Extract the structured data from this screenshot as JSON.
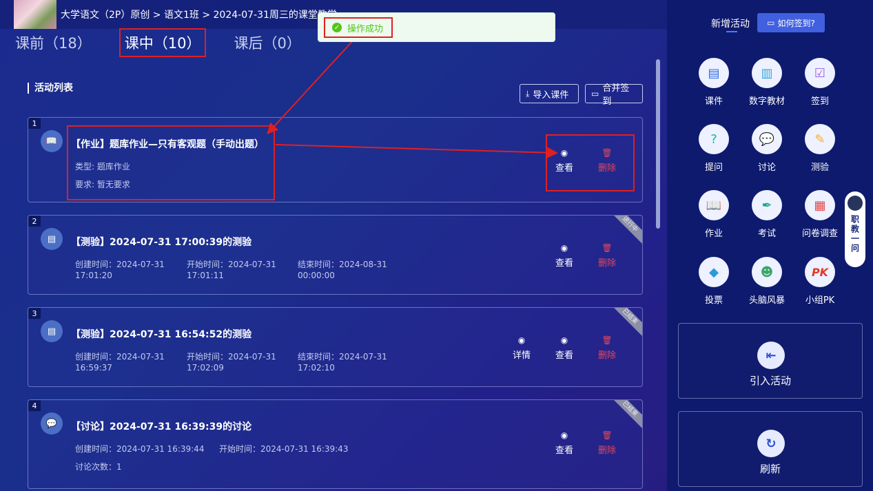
{
  "header": {
    "breadcrumb": "大学语文（2P）原创 > 语文1班 > 2024-07-31周三的课堂教学"
  },
  "tabs": [
    {
      "label": "课前（18）"
    },
    {
      "label": "课中（10）"
    },
    {
      "label": "课后（0）"
    }
  ],
  "toast": {
    "text": "操作成功"
  },
  "section": {
    "title": "活动列表",
    "import_label": "导入课件",
    "merge_label": "合并签到"
  },
  "activities": [
    {
      "index": "1",
      "title": "【作业】题库作业—只有客观题（手动出题）",
      "line1": "类型: 题库作业",
      "line2": "要求: 暂无要求",
      "view": "查看",
      "delete": "删除"
    },
    {
      "index": "2",
      "title": "【测验】2024-07-31 17:00:39的测验",
      "badge": "进行中",
      "created_label": "创建时间：2024-07-31",
      "created_time": "17:01:20",
      "start_label": "开始时间：2024-07-31",
      "start_time": "17:01:11",
      "end_label": "结束时间：2024-08-31",
      "end_time": "00:00:00",
      "view": "查看",
      "delete": "删除"
    },
    {
      "index": "3",
      "title": "【测验】2024-07-31 16:54:52的测验",
      "badge": "已结束",
      "created_label": "创建时间：2024-07-31",
      "created_time": "16:59:37",
      "start_label": "开始时间：2024-07-31",
      "start_time": "17:02:09",
      "end_label": "结束时间：2024-07-31",
      "end_time": "17:02:10",
      "detail": "详情",
      "view": "查看",
      "delete": "删除"
    },
    {
      "index": "4",
      "title": "【讨论】2024-07-31 16:39:39的讨论",
      "badge": "已结束",
      "created": "创建时间：2024-07-31 16:39:44",
      "start": "开始时间：2024-07-31 16:39:43",
      "count": "讨论次数：1",
      "view": "查看",
      "delete": "删除"
    }
  ],
  "sidebar": {
    "title": "新增活动",
    "how_btn": "如何签到?",
    "tools": [
      {
        "label": "课件",
        "icon": "courseware-icon"
      },
      {
        "label": "数字教材",
        "icon": "digital-textbook-icon"
      },
      {
        "label": "签到",
        "icon": "checkin-icon"
      },
      {
        "label": "提问",
        "icon": "question-icon"
      },
      {
        "label": "讨论",
        "icon": "discussion-icon"
      },
      {
        "label": "测验",
        "icon": "quiz-icon"
      },
      {
        "label": "作业",
        "icon": "homework-icon"
      },
      {
        "label": "考试",
        "icon": "exam-icon"
      },
      {
        "label": "问卷调查",
        "icon": "survey-icon"
      },
      {
        "label": "投票",
        "icon": "vote-icon"
      },
      {
        "label": "头脑风暴",
        "icon": "brainstorm-icon"
      },
      {
        "label": "小组PK",
        "icon": "group-pk-icon"
      }
    ],
    "import_activity": "引入活动",
    "refresh": "刷新",
    "robot": "职教一问"
  }
}
